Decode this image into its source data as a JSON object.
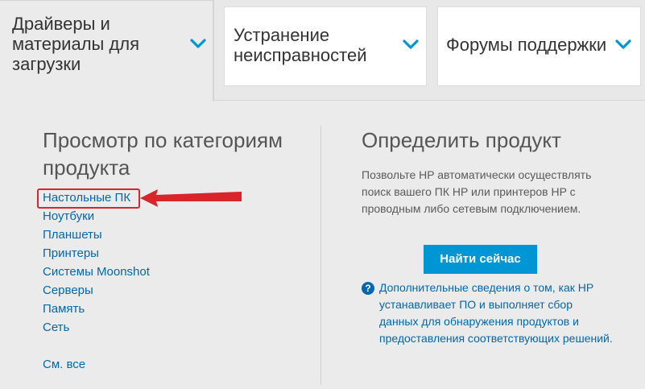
{
  "tabs": [
    {
      "label": "Драйверы и материалы для загрузки",
      "icon": "chevron-down-icon",
      "active": true
    },
    {
      "label": "Устранение неисправностей",
      "icon": "chevron-down-icon",
      "active": false
    },
    {
      "label": "Форумы поддержки",
      "icon": "chevron-down-icon",
      "active": false
    }
  ],
  "left": {
    "heading": "Просмотр по категориям продукта",
    "categories": [
      "Настольные ПК",
      "Ноутбуки",
      "Планшеты",
      "Принтеры",
      "Системы Moonshot",
      "Серверы",
      "Память",
      "Сеть"
    ],
    "see_all": "См. все"
  },
  "right": {
    "heading": "Определить продукт",
    "description": "Позвольте HP автоматически осуществлять поиск вашего ПК HP или принтеров HP с проводным либо сетевым подключением.",
    "button_label": "Найти сейчас",
    "info_icon": "question-circle-icon",
    "info_text": "Дополнительные сведения о том, как HP устанавливает ПО и выполняет сбор данных для обнаружения продуктов и предоставления соответствующих решений."
  },
  "colors": {
    "link": "#0067b0",
    "button": "#0096d6",
    "annotation": "#d8242b",
    "background": "#ebebeb"
  }
}
